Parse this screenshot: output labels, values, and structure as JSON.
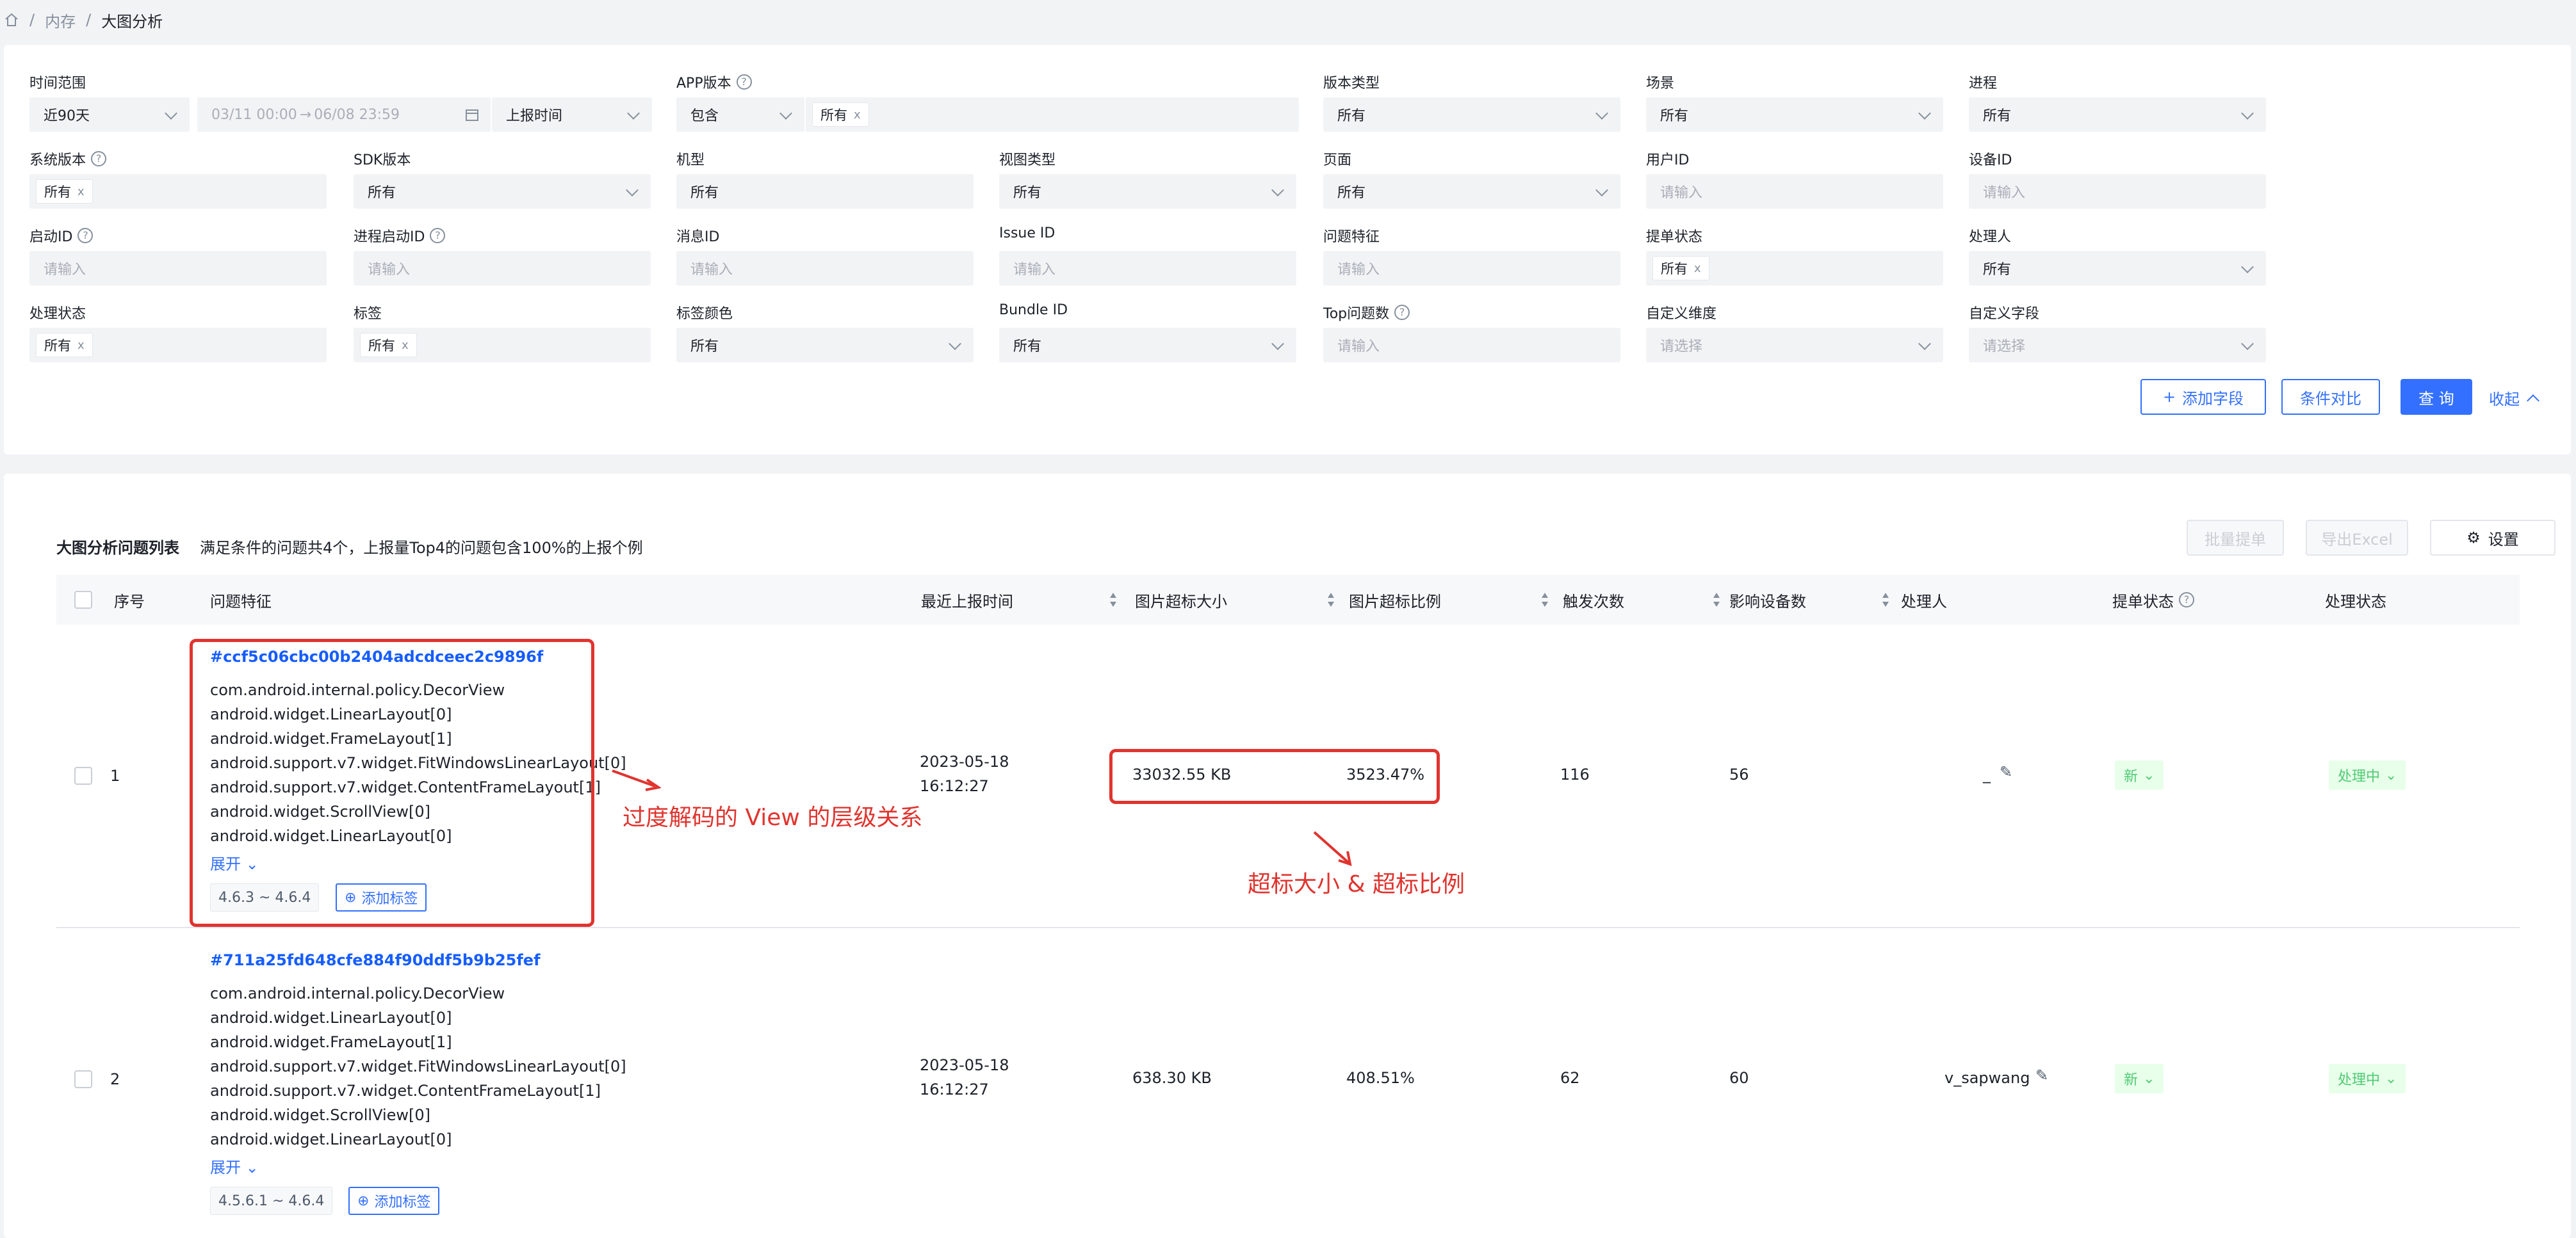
{
  "breadcrumb": {
    "items": [
      "内存",
      "大图分析"
    ]
  },
  "filters": {
    "time_range": {
      "label": "时间范围",
      "preset": "近90天",
      "start": "03/11 00:00",
      "arrow": "→",
      "end": "06/08 23:59",
      "time_type": "上报时间"
    },
    "app_version": {
      "label": "APP版本",
      "op": "包含",
      "tag": "所有"
    },
    "version_type": {
      "label": "版本类型",
      "value": "所有"
    },
    "scene": {
      "label": "场景",
      "value": "所有"
    },
    "process": {
      "label": "进程",
      "value": "所有"
    },
    "os_version": {
      "label": "系统版本",
      "tag": "所有"
    },
    "sdk_version": {
      "label": "SDK版本",
      "value": "所有"
    },
    "model": {
      "label": "机型",
      "value": "所有"
    },
    "view_type": {
      "label": "视图类型",
      "value": "所有"
    },
    "page": {
      "label": "页面",
      "value": "所有"
    },
    "user_id": {
      "label": "用户ID",
      "placeholder": "请输入"
    },
    "device_id": {
      "label": "设备ID",
      "placeholder": "请输入"
    },
    "launch_id": {
      "label": "启动ID",
      "placeholder": "请输入"
    },
    "process_launch_id": {
      "label": "进程启动ID",
      "placeholder": "请输入"
    },
    "message_id": {
      "label": "消息ID",
      "placeholder": "请输入"
    },
    "issue_id": {
      "label": "Issue ID",
      "placeholder": "请输入"
    },
    "issue_feature": {
      "label": "问题特征",
      "placeholder": "请输入"
    },
    "submit_status": {
      "label": "提单状态",
      "tag": "所有"
    },
    "handler": {
      "label": "处理人",
      "value": "所有"
    },
    "handle_status": {
      "label": "处理状态",
      "tag": "所有"
    },
    "label_tag": {
      "label": "标签",
      "tag": "所有"
    },
    "label_color": {
      "label": "标签颜色",
      "value": "所有"
    },
    "bundle_id": {
      "label": "Bundle ID",
      "value": "所有"
    },
    "top_issues": {
      "label": "Top问题数",
      "placeholder": "请输入"
    },
    "custom_dim": {
      "label": "自定义维度",
      "placeholder": "请选择"
    },
    "custom_field": {
      "label": "自定义字段",
      "placeholder": "请选择"
    },
    "actions": {
      "add_field": "添加字段",
      "compare": "条件对比",
      "query": "查 询",
      "collapse": "收起"
    }
  },
  "list": {
    "title": "大图分析问题列表",
    "summary": "满足条件的问题共4个，上报量Top4的问题包含100%的上报个例",
    "batch_submit": "批量提单",
    "export": "导出Excel",
    "settings": "设置",
    "columns": [
      "序号",
      "问题特征",
      "最近上报时间",
      "图片超标大小",
      "图片超标比例",
      "触发次数",
      "影响设备数",
      "处理人",
      "提单状态",
      "处理状态"
    ],
    "rows": [
      {
        "index": "1",
        "hash": "#ccf5c06cbc00b2404adcdceec2c9896f",
        "views": [
          "com.android.internal.policy.DecorView",
          "android.widget.LinearLayout[0]",
          "android.widget.FrameLayout[1]",
          "android.support.v7.widget.FitWindowsLinearLayout[0]",
          "android.support.v7.widget.ContentFrameLayout[1]",
          "android.widget.ScrollView[0]",
          "android.widget.LinearLayout[0]"
        ],
        "expand": "展开",
        "version": "4.6.3 ~ 4.6.4",
        "add_tag": "添加标签",
        "date": "2023-05-18",
        "time": "16:12:27",
        "size": "33032.55 KB",
        "ratio": "3523.47%",
        "triggers": "116",
        "devices": "56",
        "handler": "_",
        "submit": "新",
        "status": "处理中"
      },
      {
        "index": "2",
        "hash": "#711a25fd648cfe884f90ddf5b9b25fef",
        "views": [
          "com.android.internal.policy.DecorView",
          "android.widget.LinearLayout[0]",
          "android.widget.FrameLayout[1]",
          "android.support.v7.widget.FitWindowsLinearLayout[0]",
          "android.support.v7.widget.ContentFrameLayout[1]",
          "android.widget.ScrollView[0]",
          "android.widget.LinearLayout[0]"
        ],
        "expand": "展开",
        "version": "4.5.6.1 ~ 4.6.4",
        "add_tag": "添加标签",
        "date": "2023-05-18",
        "time": "16:12:27",
        "size": "638.30 KB",
        "ratio": "408.51%",
        "triggers": "62",
        "devices": "60",
        "handler": "v_sapwang",
        "submit": "新",
        "status": "处理中"
      }
    ]
  },
  "annotations": {
    "hierarchy": "过度解码的 View 的层级关系",
    "size_ratio": "超标大小 & 超标比例"
  },
  "colors": {
    "accent": "#3370ff",
    "annotation": "#e0342f",
    "status_green": "#4ecb73"
  }
}
